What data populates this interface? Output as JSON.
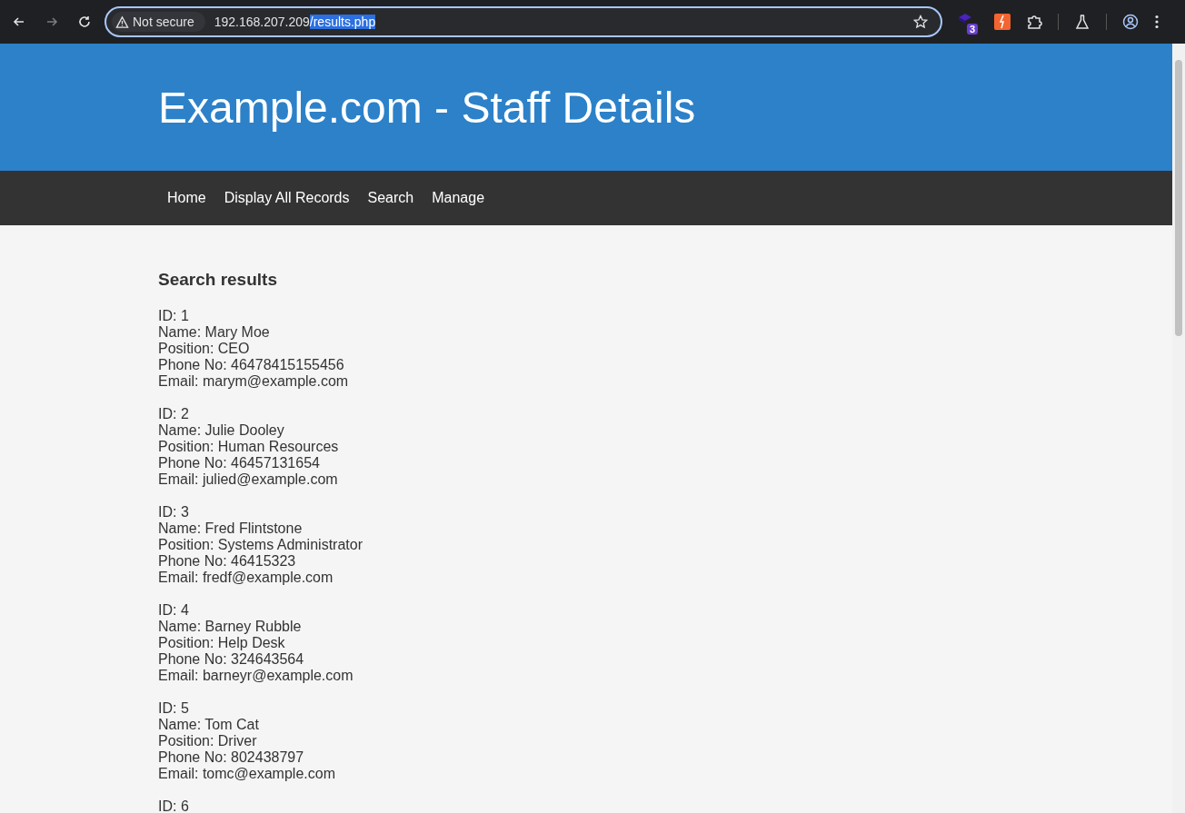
{
  "browser": {
    "security_label": "Not secure",
    "url_parts": [
      {
        "text": "192.168.207.209",
        "selected": false
      },
      {
        "text": "/results.php",
        "selected": true
      }
    ],
    "extension_badge": "3"
  },
  "header": {
    "title": "Example.com - Staff Details"
  },
  "nav": {
    "items": [
      {
        "label": "Home"
      },
      {
        "label": "Display All Records"
      },
      {
        "label": "Search"
      },
      {
        "label": "Manage"
      }
    ]
  },
  "content": {
    "heading": "Search results",
    "records": [
      {
        "lines": [
          "ID: 1",
          "Name: Mary Moe",
          "Position: CEO",
          "Phone No: 46478415155456",
          "Email: marym@example.com"
        ]
      },
      {
        "lines": [
          "ID: 2",
          "Name: Julie Dooley",
          "Position: Human Resources",
          "Phone No: 46457131654",
          "Email: julied@example.com"
        ]
      },
      {
        "lines": [
          "ID: 3",
          "Name: Fred Flintstone",
          "Position: Systems Administrator",
          "Phone No: 46415323",
          "Email: fredf@example.com"
        ]
      },
      {
        "lines": [
          "ID: 4",
          "Name: Barney Rubble",
          "Position: Help Desk",
          "Phone No: 324643564",
          "Email: barneyr@example.com"
        ]
      },
      {
        "lines": [
          "ID: 5",
          "Name: Tom Cat",
          "Position: Driver",
          "Phone No: 802438797",
          "Email: tomc@example.com"
        ]
      },
      {
        "lines": [
          "ID: 6"
        ]
      }
    ]
  }
}
